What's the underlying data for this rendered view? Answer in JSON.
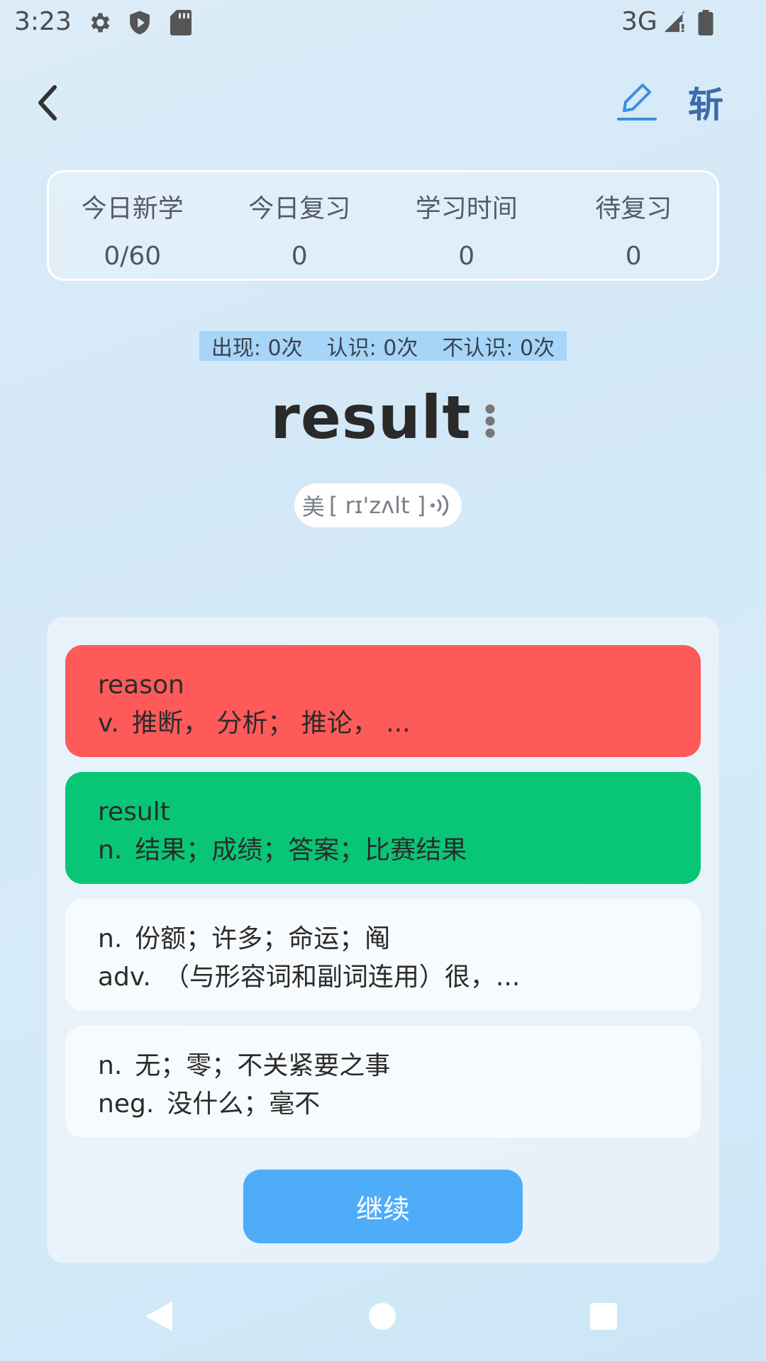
{
  "status_bar": {
    "time": "3:23",
    "network": "3G",
    "icons": [
      "settings-icon",
      "shield-icon",
      "sd-card-icon",
      "signal-icon",
      "battery-icon"
    ]
  },
  "header": {
    "back_icon": "chevron-left-icon",
    "edit_icon": "pencil-icon",
    "slash_label": "斩"
  },
  "stats": [
    {
      "label": "今日新学",
      "value": "0/60"
    },
    {
      "label": "今日复习",
      "value": "0"
    },
    {
      "label": "学习时间",
      "value": "0"
    },
    {
      "label": "待复习",
      "value": "0"
    }
  ],
  "counters": {
    "appear": "出现: 0次",
    "known": "认识: 0次",
    "unknown": "不认识: 0次"
  },
  "word": {
    "text": "result",
    "more_icon": "more-vertical-icon",
    "phonetic_region": "美",
    "phonetic": "[ rɪ'zʌlt ]",
    "audio_icon": "speaker-icon"
  },
  "options": [
    {
      "line1": "reason",
      "line2_pos": "v.",
      "line2_text": "推断， 分析； 推论， ...",
      "state": "wrong",
      "color": "#fe5a5a"
    },
    {
      "line1": "result",
      "line2_pos": "n.",
      "line2_text": "结果；成绩；答案；比赛结果",
      "state": "correct",
      "color": "#09c676"
    },
    {
      "line1_pos": "n.",
      "line1_text": "份额；许多；命运；阄",
      "line2_pos": "adv.",
      "line2_text": "（与形容词和副词连用）很，...",
      "state": "neutral"
    },
    {
      "line1_pos": "n.",
      "line1_text": "无；零；不关紧要之事",
      "line2_pos": "neg.",
      "line2_text": "没什么；毫不",
      "state": "neutral"
    }
  ],
  "continue_label": "继续",
  "colors": {
    "accent": "#4eacf9",
    "counter_bg": "#a6d5f7",
    "header_blue": "#3d6aa8"
  },
  "nav_bar": {
    "back_icon": "nav-back-icon",
    "home_icon": "nav-home-icon",
    "recents_icon": "nav-recents-icon"
  }
}
